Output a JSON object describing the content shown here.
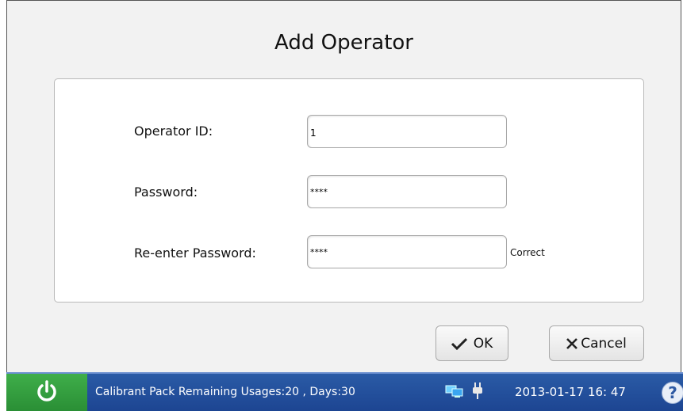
{
  "dialog": {
    "title": "Add Operator",
    "operator_id": {
      "label": "Operator ID:",
      "value": "1"
    },
    "password": {
      "label": "Password:",
      "value": "****"
    },
    "reenter_password": {
      "label": "Re-enter Password:",
      "value": "****",
      "status": "Correct"
    },
    "ok_label": "OK",
    "cancel_label": "Cancel"
  },
  "status_bar": {
    "message": "Calibrant Pack Remaining Usages:20 , Days:30",
    "datetime": "2013-01-17  16: 47",
    "help_symbol": "?",
    "icons": [
      "power-icon",
      "network-icon",
      "plug-icon",
      "help-icon"
    ],
    "colors": {
      "bar": "#1d4592",
      "power": "#2a8f35"
    }
  }
}
